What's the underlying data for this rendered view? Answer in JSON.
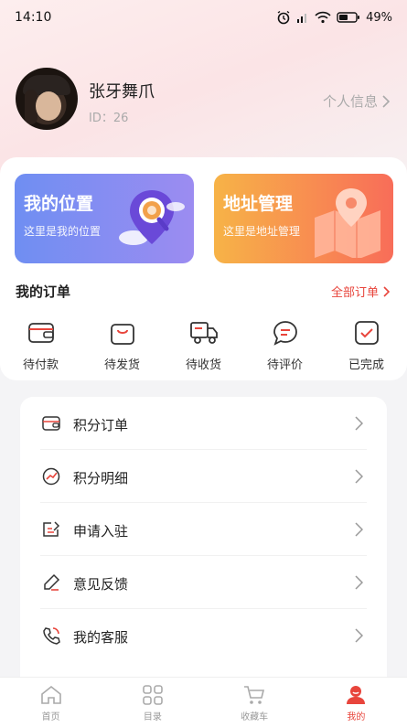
{
  "status_bar": {
    "time": "14:10",
    "battery": "49%"
  },
  "profile": {
    "name": "张牙舞爪",
    "id_label": "ID：26",
    "info_link": "个人信息"
  },
  "tiles": [
    {
      "title": "我的位置",
      "subtitle": "这里是我的位置"
    },
    {
      "title": "地址管理",
      "subtitle": "这里是地址管理"
    }
  ],
  "orders": {
    "title": "我的订单",
    "all_label": "全部订单",
    "items": [
      {
        "label": "待付款",
        "icon": "wallet-icon"
      },
      {
        "label": "待发货",
        "icon": "bag-icon"
      },
      {
        "label": "待收货",
        "icon": "truck-icon"
      },
      {
        "label": "待评价",
        "icon": "chat-icon"
      },
      {
        "label": "已完成",
        "icon": "check-icon"
      }
    ]
  },
  "menu": [
    {
      "label": "积分订单",
      "icon": "wallet-icon"
    },
    {
      "label": "积分明细",
      "icon": "trend-icon"
    },
    {
      "label": "申请入驻",
      "icon": "edit-icon"
    },
    {
      "label": "意见反馈",
      "icon": "pen-icon"
    },
    {
      "label": "我的客服",
      "icon": "phone-icon"
    }
  ],
  "tabbar": [
    {
      "label": "首页",
      "icon": "home-icon"
    },
    {
      "label": "目录",
      "icon": "grid-icon"
    },
    {
      "label": "收藏车",
      "icon": "cart-icon"
    },
    {
      "label": "我的",
      "icon": "user-icon",
      "active": true
    }
  ],
  "colors": {
    "accent": "#e8453c",
    "tile_location": "#7f8df2",
    "tile_address": "#f7934f"
  }
}
